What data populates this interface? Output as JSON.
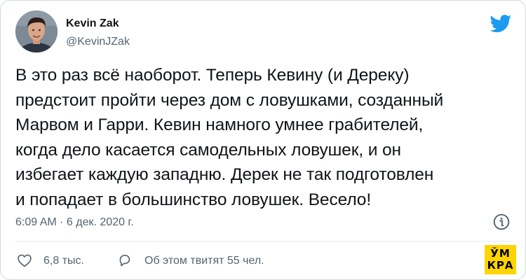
{
  "tweet": {
    "author_name": "Kevin Zak",
    "author_handle": "@KevinJZak",
    "text": "В это раз всё наоборот. Теперь Кевину (и Дереку)\nпредстоит пройти через дом с ловушками, созданный\nМарвом и Гарри. Кевин намного умнее грабителей,\nкогда дело касается самодельных ловушек, и он\nизбегает каждую западню. Дерек не так подготовлен\nи попадает в большинство ловушек. Весело!",
    "timestamp": "6:09 AM · 6 дек. 2020 г.",
    "likes": "6,8 тыс.",
    "discussion": "Об этом твитят 55 чел."
  },
  "logo": {
    "line1": "ЎМ",
    "line2": "КРА"
  },
  "icons": {
    "brand": "twitter-bird-icon",
    "info": "info-icon",
    "like": "heart-icon",
    "reply": "speech-bubble-icon"
  },
  "colors": {
    "twitter_blue": "#1d9bf0",
    "text_primary": "#0f1419",
    "text_secondary": "#536471",
    "logo_yellow": "#ffd400"
  }
}
